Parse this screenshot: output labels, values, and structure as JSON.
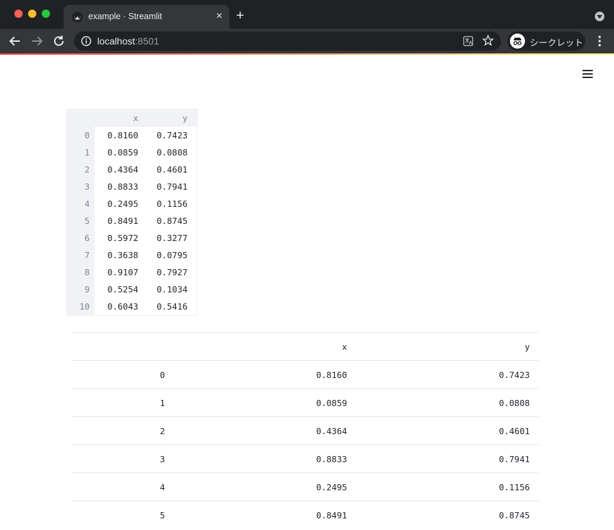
{
  "browser": {
    "tab_title": "example · Streamlit",
    "url_host": "localhost",
    "url_port": ":8501",
    "incognito_label": "シークレット",
    "tab_close": "×",
    "new_tab": "+"
  },
  "dataframe": {
    "columns": [
      "",
      "x",
      "y"
    ],
    "rows": [
      [
        "0",
        "0.8160",
        "0.7423"
      ],
      [
        "1",
        "0.0859",
        "0.0808"
      ],
      [
        "2",
        "0.4364",
        "0.4601"
      ],
      [
        "3",
        "0.8833",
        "0.7941"
      ],
      [
        "4",
        "0.2495",
        "0.1156"
      ],
      [
        "5",
        "0.8491",
        "0.8745"
      ],
      [
        "6",
        "0.5972",
        "0.3277"
      ],
      [
        "7",
        "0.3638",
        "0.0795"
      ],
      [
        "8",
        "0.9107",
        "0.7927"
      ],
      [
        "9",
        "0.5254",
        "0.1034"
      ],
      [
        "10",
        "0.6043",
        "0.5416"
      ]
    ]
  },
  "static_table": {
    "columns": [
      "",
      "x",
      "y"
    ],
    "rows": [
      [
        "0",
        "0.8160",
        "0.7423"
      ],
      [
        "1",
        "0.0859",
        "0.0808"
      ],
      [
        "2",
        "0.4364",
        "0.4601"
      ],
      [
        "3",
        "0.8833",
        "0.7941"
      ],
      [
        "4",
        "0.2495",
        "0.1156"
      ],
      [
        "5",
        "0.8491",
        "0.8745"
      ]
    ]
  },
  "colors": {
    "accent_red": "#ff4b4b",
    "accent_yellow": "#fffd80",
    "chrome_dark": "#202124",
    "chrome_toolbar": "#35363a"
  },
  "icons": [
    "streamlit-favicon-icon",
    "close-icon",
    "plus-icon",
    "chevron-down-icon",
    "back-arrow-icon",
    "forward-arrow-icon",
    "reload-icon",
    "info-icon",
    "translate-icon",
    "star-icon",
    "incognito-icon",
    "more-vert-icon",
    "hamburger-menu-icon"
  ]
}
